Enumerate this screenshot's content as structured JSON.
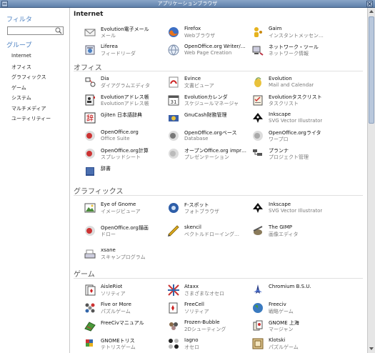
{
  "window": {
    "title": "アプリケーションブラウザ"
  },
  "sidebar": {
    "filter_heading": "フィルタ",
    "filter_value": "",
    "group_heading": "グループ",
    "items": [
      {
        "label": "Internet",
        "selected": true
      },
      {
        "label": "オフィス"
      },
      {
        "label": "グラフィックス"
      },
      {
        "label": "ゲーム"
      },
      {
        "label": "システム"
      },
      {
        "label": "マルチメディア"
      },
      {
        "label": "ユーティリティー"
      }
    ]
  },
  "categories": {
    "internet": {
      "heading": "Internet",
      "apps": [
        {
          "name": "Evolution電子メール",
          "desc": "メール",
          "icon": "mail-icon"
        },
        {
          "name": "Firefox",
          "desc": "Webブラウザ",
          "icon": "firefox-icon"
        },
        {
          "name": "Gaim",
          "desc": "インスタントメッセン…",
          "icon": "gaim-icon"
        },
        {
          "name": "Liferea",
          "desc": "フィードリーダ",
          "icon": "feed-reader-icon"
        },
        {
          "name": "OpenOffice.org Writer/…",
          "desc": "Web Page Creation",
          "icon": "web-writer-icon"
        },
        {
          "name": "ネットワーク・ツール",
          "desc": "ネットワーク情報",
          "icon": "network-tools-icon"
        }
      ]
    },
    "office": {
      "heading": "オフィス",
      "apps": [
        {
          "name": "Dia",
          "desc": "ダイアグラムエディタ",
          "icon": "dia-icon"
        },
        {
          "name": "Evince",
          "desc": "文書ビューア",
          "icon": "evince-icon"
        },
        {
          "name": "Evolution",
          "desc": "Mail and Calendar",
          "icon": "evolution-icon"
        },
        {
          "name": "Evolutionアドレス帳",
          "desc": "Evolutionアドレス帳",
          "icon": "address-book-icon"
        },
        {
          "name": "Evolutionカレンダ",
          "desc": "スケジュールマネージャ",
          "icon": "calendar-icon"
        },
        {
          "name": "Evolutionタスクリスト",
          "desc": "タスクリスト",
          "icon": "task-list-icon"
        },
        {
          "name": "Gjiten 日本語辞典",
          "desc": "",
          "icon": "gjiten-icon"
        },
        {
          "name": "GnuCash財務管理",
          "desc": "",
          "icon": "gnucash-icon"
        },
        {
          "name": "Inkscape",
          "desc": "SVG Vector Illustrator",
          "icon": "inkscape-icon"
        },
        {
          "name": "OpenOffice.org",
          "desc": "Office Suite",
          "icon": "openoffice-icon"
        },
        {
          "name": "OpenOffice.orgベース",
          "desc": "Database",
          "icon": "oo-base-icon"
        },
        {
          "name": "OpenOffice.orgライタ",
          "desc": "ワープロ",
          "icon": "oo-writer-icon"
        },
        {
          "name": "OpenOffice.org計算",
          "desc": "スプレッドシート",
          "icon": "oo-calc-icon"
        },
        {
          "name": "オープンOffice.org impr…",
          "desc": "プレゼンテーション",
          "icon": "oo-impress-icon"
        },
        {
          "name": "プランナ",
          "desc": "プロジェクト管理",
          "icon": "planner-icon"
        },
        {
          "name": "辞書",
          "desc": "",
          "icon": "dictionary-icon"
        }
      ]
    },
    "graphics": {
      "heading": "グラフィックス",
      "apps": [
        {
          "name": "Eye of Gnome",
          "desc": "イメージビューア",
          "icon": "eog-icon"
        },
        {
          "name": "F-スポット",
          "desc": "フォトブラウザ",
          "icon": "fspot-icon"
        },
        {
          "name": "Inkscape",
          "desc": "SVG Vector Illustrator",
          "icon": "inkscape-icon"
        },
        {
          "name": "OpenOffice.org描画",
          "desc": "ドロー",
          "icon": "oo-draw-icon"
        },
        {
          "name": "skencil",
          "desc": "ベクトルドローイング…",
          "icon": "skencil-icon"
        },
        {
          "name": "The GIMP",
          "desc": "画像エディタ",
          "icon": "gimp-icon"
        },
        {
          "name": "xsane",
          "desc": "スキャンプログラム",
          "icon": "xsane-icon"
        }
      ]
    },
    "games": {
      "heading": "ゲーム",
      "apps": [
        {
          "name": "AisleRiot",
          "desc": "ソリティア",
          "icon": "aisleriot-icon"
        },
        {
          "name": "Ataxx",
          "desc": "さまざまなオセロ",
          "icon": "ataxx-icon"
        },
        {
          "name": "Chromium B.S.U.",
          "desc": "",
          "icon": "chromium-icon"
        },
        {
          "name": "Five or More",
          "desc": "パズルゲーム",
          "icon": "five-or-more-icon"
        },
        {
          "name": "FreeCell",
          "desc": "ソリティア",
          "icon": "freecell-icon"
        },
        {
          "name": "Freeciv",
          "desc": "戦略ゲーム",
          "icon": "freeciv-icon"
        },
        {
          "name": "FreeCivマニュアル",
          "desc": "",
          "icon": "freeciv-manual-icon"
        },
        {
          "name": "Frozen-Bubble",
          "desc": "2Dシューティング",
          "icon": "frozen-bubble-icon"
        },
        {
          "name": "GNOME 上海",
          "desc": "マージャン",
          "icon": "mahjongg-icon"
        },
        {
          "name": "GNOMEトリス",
          "desc": "テトリスゲーム",
          "icon": "gnometris-icon"
        },
        {
          "name": "Iagno",
          "desc": "オセロ",
          "icon": "iagno-icon"
        },
        {
          "name": "Klotski",
          "desc": "パズルゲーム",
          "icon": "klotski-icon"
        }
      ]
    }
  }
}
